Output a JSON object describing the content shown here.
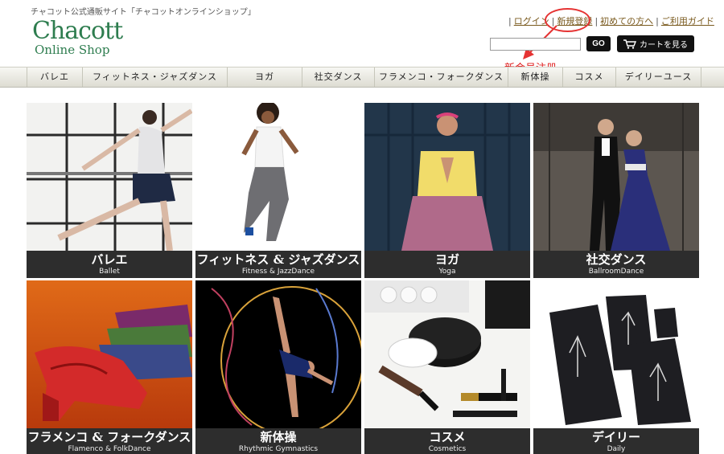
{
  "header": {
    "tagline": "チャコット公式通販サイト「チャコットオンラインショップ」",
    "logo_main": "Chacott",
    "logo_sub": "Online Shop",
    "links": [
      "ログイン",
      "新規登録",
      "初めての方へ",
      "ご利用ガイド"
    ],
    "annotation": "新会员注册",
    "search_value": "",
    "go_label": "GO",
    "cart_label": "カートを見る"
  },
  "nav": {
    "items": [
      "バレエ",
      "フィットネス・ジャズダンス",
      "ヨガ",
      "社交ダンス",
      "フラメンコ・フォークダンス",
      "新体操",
      "コスメ",
      "デイリーユース"
    ]
  },
  "tiles": [
    {
      "jp": "バレエ",
      "en": "Ballet"
    },
    {
      "jp": "フィットネス & ジャズダンス",
      "en": "Fitness & JazzDance"
    },
    {
      "jp": "ヨガ",
      "en": "Yoga"
    },
    {
      "jp": "社交ダンス",
      "en": "BallroomDance"
    },
    {
      "jp": "フラメンコ & フォークダンス",
      "en": "Flamenco & FolkDance"
    },
    {
      "jp": "新体操",
      "en": "Rhythmic Gymnastics"
    },
    {
      "jp": "コスメ",
      "en": "Cosmetics"
    },
    {
      "jp": "デイリー",
      "en": "Daily"
    }
  ],
  "colors": {
    "brand_green": "#2e7d4f",
    "annotation_red": "#e02020",
    "caption_bg": "#2d2d2d"
  }
}
